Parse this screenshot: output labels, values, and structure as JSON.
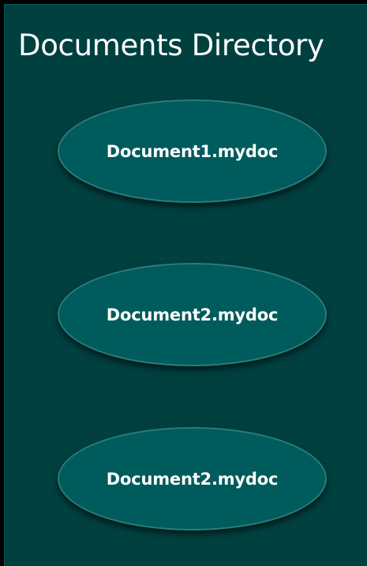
{
  "panel": {
    "title": "Documents Directory"
  },
  "documents": [
    {
      "label": "Document1.mydoc"
    },
    {
      "label": "Document2.mydoc"
    },
    {
      "label": "Document2.mydoc"
    }
  ],
  "colors": {
    "background": "#000000",
    "panel": "#00403f",
    "node_fill": "#005b5c",
    "node_border": "#2a7c7c",
    "text": "#ffffff"
  }
}
